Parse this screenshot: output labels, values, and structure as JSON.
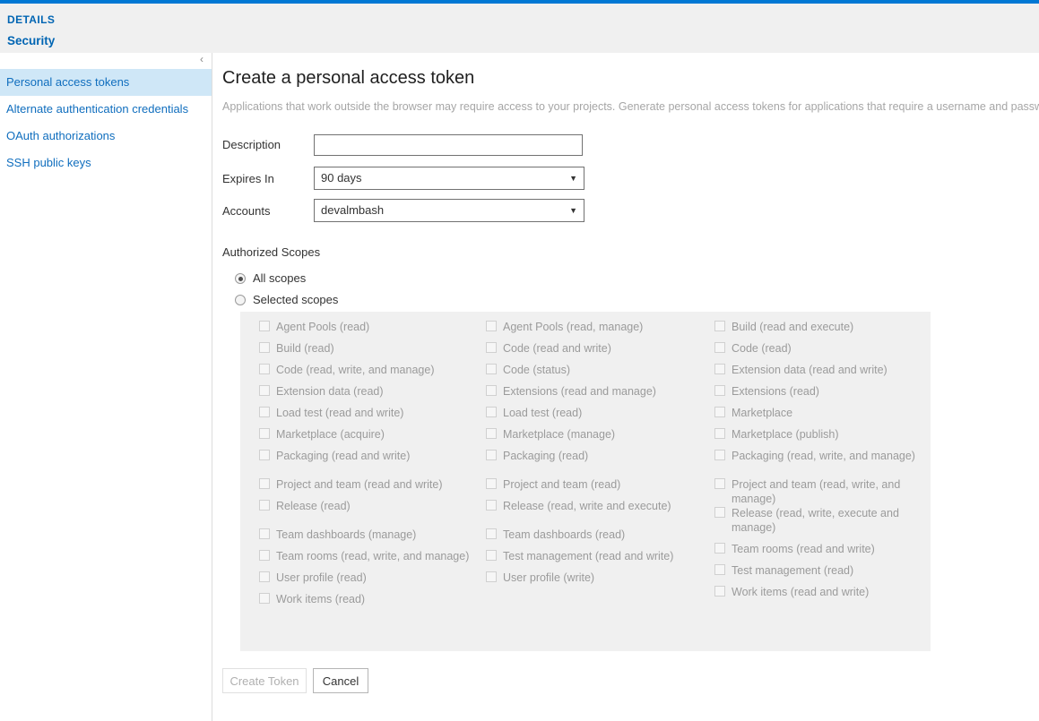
{
  "header": {
    "details_label": "DETAILS",
    "security_tab": "Security",
    "accent_color": "#0078d4"
  },
  "sidebar": {
    "collapse_icon": "chevron-left-icon",
    "items": [
      {
        "label": "Personal access tokens",
        "selected": true
      },
      {
        "label": "Alternate authentication credentials",
        "selected": false
      },
      {
        "label": "OAuth authorizations",
        "selected": false
      },
      {
        "label": "SSH public keys",
        "selected": false
      }
    ]
  },
  "main": {
    "title": "Create a personal access token",
    "description": "Applications that work outside the browser may require access to your projects. Generate personal access tokens for applications that require a username and password.",
    "form": {
      "description_label": "Description",
      "description_value": "",
      "description_placeholder": "",
      "expires_label": "Expires In",
      "expires_value": "90 days",
      "accounts_label": "Accounts",
      "accounts_value": "devalmbash",
      "dropdown_arrow": "▼"
    },
    "scopes": {
      "heading": "Authorized Scopes",
      "radio_all": "All scopes",
      "radio_selected": "Selected scopes",
      "selected_radio": "all",
      "columns": [
        [
          "Agent Pools (read)",
          "Build (read)",
          "Code (read, write, and manage)",
          "Extension data (read)",
          "Load test (read and write)",
          "Marketplace (acquire)",
          "Packaging (read and write)",
          "Project and team (read and write)",
          "Release (read)",
          "Team dashboards (manage)",
          "Team rooms (read, write, and manage)",
          "User profile (read)",
          "Work items (read)"
        ],
        [
          "Agent Pools (read, manage)",
          "Code (read and write)",
          "Code (status)",
          "Extensions (read and manage)",
          "Load test (read)",
          "Marketplace (manage)",
          "Packaging (read)",
          "Project and team (read)",
          "Release (read, write and execute)",
          "Team dashboards (read)",
          "Test management (read and write)",
          "User profile (write)"
        ],
        [
          "Build (read and execute)",
          "Code (read)",
          "Extension data (read and write)",
          "Extensions (read)",
          "Marketplace",
          "Marketplace (publish)",
          "Packaging (read, write, and manage)",
          "Project and team (read, write, and manage)",
          "Release (read, write, execute and manage)",
          "Team rooms (read and write)",
          "Test management (read)",
          "Work items (read and write)"
        ]
      ]
    },
    "buttons": {
      "create": "Create Token",
      "create_enabled": false,
      "cancel": "Cancel"
    }
  }
}
